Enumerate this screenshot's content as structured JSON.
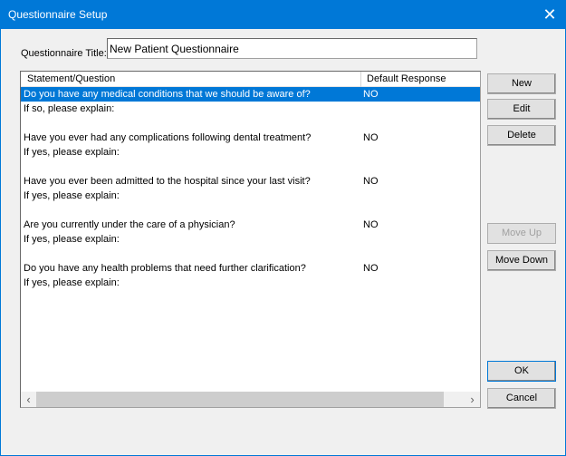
{
  "window": {
    "title": "Questionnaire Setup"
  },
  "title_field": {
    "label": "Questionnaire Title:",
    "value": "New Patient Questionnaire"
  },
  "list": {
    "columns": [
      "Statement/Question",
      "Default Response"
    ],
    "rows": [
      {
        "question": "Do you have any medical conditions that we should be aware of?",
        "response": "NO",
        "followup": "If so, please explain:",
        "selected": true
      },
      {
        "question": "Have you ever had any complications following dental treatment?",
        "response": "NO",
        "followup": "If yes, please explain:"
      },
      {
        "question": "Have you ever been admitted to the hospital since your last visit?",
        "response": "NO",
        "followup": "If yes, please explain:"
      },
      {
        "question": "Are you currently under the care of a physician?",
        "response": "NO",
        "followup": "If yes, please explain:"
      },
      {
        "question": "Do you have any health problems that need further clarification?",
        "response": "NO",
        "followup": "If yes, please explain:"
      }
    ]
  },
  "buttons": {
    "new": "New",
    "edit": "Edit",
    "delete": "Delete",
    "move_up": "Move Up",
    "move_down": "Move Down",
    "ok": "OK",
    "cancel": "Cancel"
  },
  "colors": {
    "accent": "#0078d7"
  }
}
